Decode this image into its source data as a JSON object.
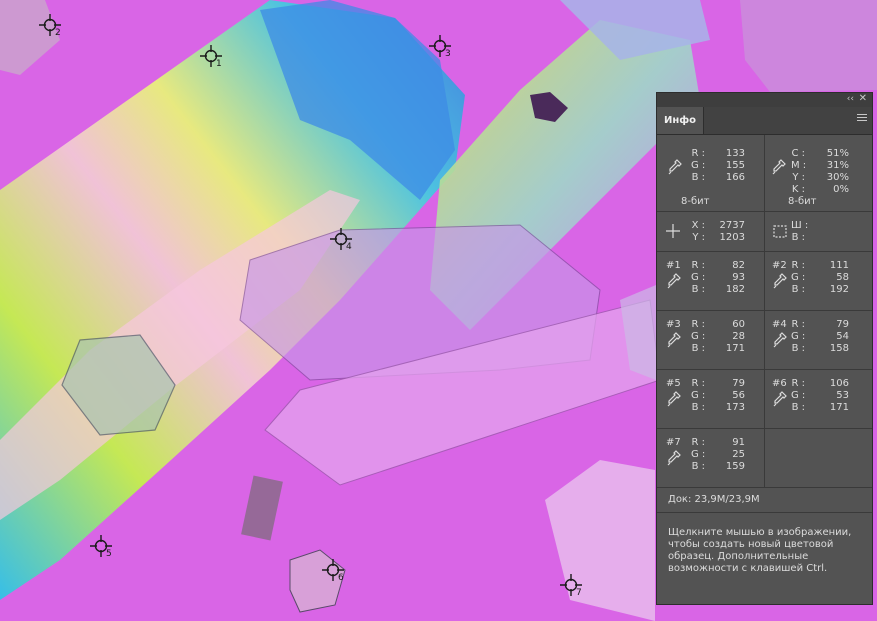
{
  "panel": {
    "tab": "Инфо",
    "collapse_label": "‹‹",
    "close_label": "✕",
    "readouts": {
      "rgb": {
        "R": "133",
        "G": "155",
        "B": "166",
        "depth": "8-бит"
      },
      "cmyk": {
        "C": "51%",
        "M": "31%",
        "Y": "30%",
        "K": "0%",
        "depth": "8-бит"
      },
      "position": {
        "X": "2737",
        "Y": "1203"
      },
      "size": {
        "W": "",
        "H": ""
      }
    },
    "labels": {
      "R": "R :",
      "G": "G :",
      "B": "B :",
      "C": "C :",
      "M": "M :",
      "Y": "Y :",
      "K": "K :",
      "X": "X :",
      "Yp": "Y :",
      "W": "Ш :",
      "H": "В :"
    },
    "samplers": [
      {
        "num": "#1",
        "R": "82",
        "G": "93",
        "B": "182"
      },
      {
        "num": "#2",
        "R": "111",
        "G": "58",
        "B": "192"
      },
      {
        "num": "#3",
        "R": "60",
        "G": "28",
        "B": "171"
      },
      {
        "num": "#4",
        "R": "79",
        "G": "54",
        "B": "158"
      },
      {
        "num": "#5",
        "R": "79",
        "G": "56",
        "B": "173"
      },
      {
        "num": "#6",
        "R": "106",
        "G": "53",
        "B": "171"
      },
      {
        "num": "#7",
        "R": "91",
        "G": "25",
        "B": "159"
      }
    ],
    "doc": "Док: 23,9M/23,9M",
    "hint": "Щелкните мышью в изображении, чтобы создать новый цветовой образец. Дополнительные возможности с клавишей Ctrl."
  },
  "canvas_markers": [
    {
      "label": "2"
    },
    {
      "label": "1"
    },
    {
      "label": "3"
    },
    {
      "label": "4"
    },
    {
      "label": "5"
    },
    {
      "label": "6"
    },
    {
      "label": "7"
    }
  ],
  "colors": {
    "background": "#d965e6",
    "panel": "#535353",
    "panel_dark": "#424242",
    "text": "#dcdcdc"
  }
}
